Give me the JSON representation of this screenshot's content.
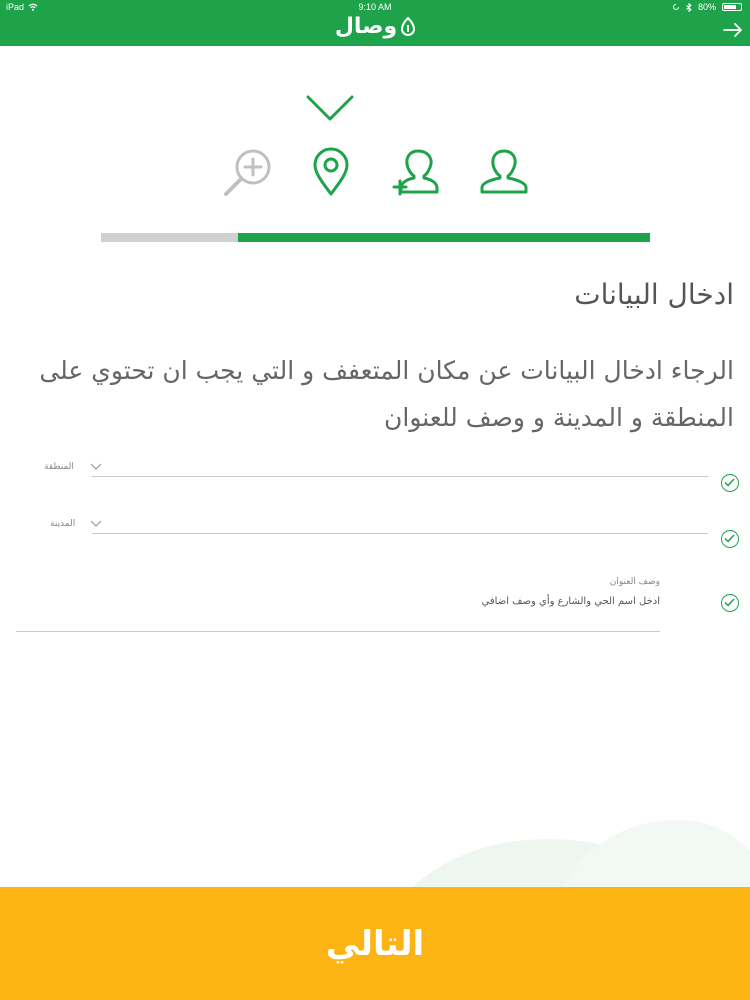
{
  "status_bar": {
    "carrier": "iPad",
    "time": "9:10 AM",
    "battery": "80%",
    "battery_level": 0.8
  },
  "header": {
    "logo_text": "وصال",
    "back_icon": "arrow-right-icon"
  },
  "stepper": {
    "icons": [
      "magnifier-plus-icon",
      "location-pin-icon",
      "user-add-icon",
      "user-icon"
    ],
    "active_icon": "location-pin-icon",
    "progress": 0.75
  },
  "page": {
    "title": "ادخال البيانات",
    "description": "الرجاء ادخال البيانات عن مكان المتعفف و التي يجب ان تحتوي على المنطقة و المدينة و وصف للعنوان"
  },
  "form": {
    "region_label": "المنطقة",
    "city_label": "المدينة",
    "address_label": "وصف العنوان",
    "address_placeholder": "ادخل اسم الحي والشارع وأي وصف اضافي"
  },
  "footer": {
    "next_label": "التالي"
  },
  "colors": {
    "primary": "#1fa34a",
    "accent": "#fcb414",
    "inactive": "#c0c0c0"
  }
}
